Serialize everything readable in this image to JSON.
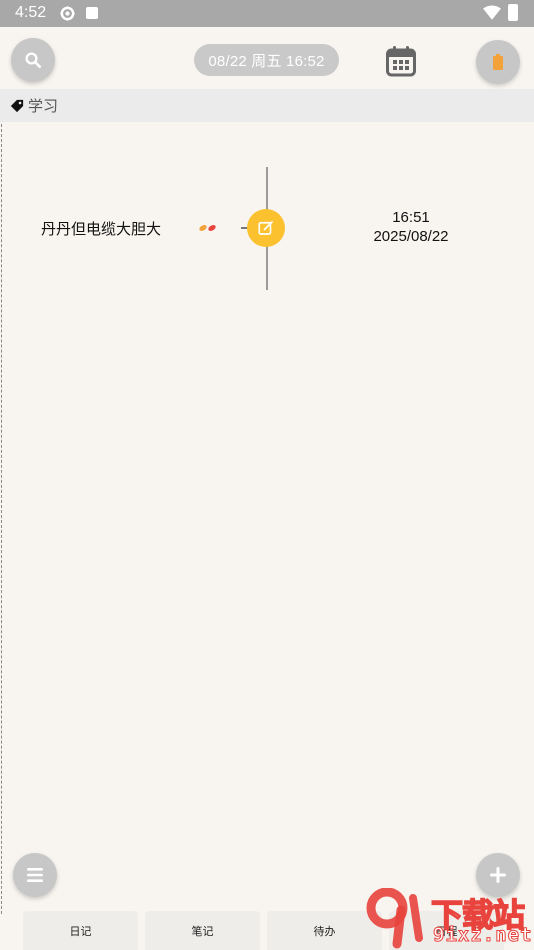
{
  "status_bar": {
    "time": "4:52"
  },
  "header": {
    "date_pill": "08/22 周五  16:52"
  },
  "category": {
    "label": "学习"
  },
  "entry": {
    "text": "丹丹但电缆大胆大",
    "time": "16:51",
    "date": "2025/08/22"
  },
  "tabs": [
    {
      "label": "日记"
    },
    {
      "label": "笔记"
    },
    {
      "label": "待办"
    },
    {
      "label": "日程"
    }
  ],
  "watermark": {
    "brand": "下载站",
    "domain": "9ixz.net"
  },
  "colors": {
    "accent": "#fbc12e",
    "background": "#f8f5f0",
    "status_bar": "#a8a8a8",
    "battery_icon": "#f3a23a"
  },
  "icons": [
    "gear-icon",
    "a-icon",
    "wifi-icon",
    "battery-icon",
    "search-icon",
    "calendar-icon",
    "tag-icon",
    "edit-icon",
    "menu-icon",
    "plus-icon"
  ]
}
